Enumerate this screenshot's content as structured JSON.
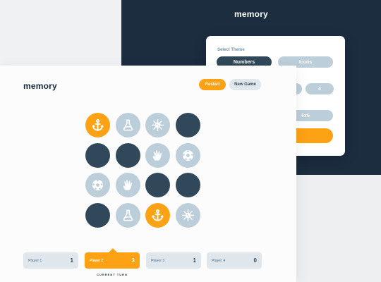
{
  "start_screen": {
    "logo": "memory",
    "select_theme_label": "Select Theme",
    "themes": [
      "Numbers",
      "Icons"
    ],
    "active_theme": "Numbers",
    "visible_player_option": "4",
    "visible_grid_option": "6x6"
  },
  "game": {
    "logo": "memory",
    "restart_label": "Restart",
    "new_game_label": "New Game",
    "tiles": [
      {
        "state": "active",
        "icon": "anchor-icon"
      },
      {
        "state": "revealed",
        "icon": "flask-icon"
      },
      {
        "state": "revealed",
        "icon": "virus-icon"
      },
      {
        "state": "hidden",
        "icon": ""
      },
      {
        "state": "hidden",
        "icon": ""
      },
      {
        "state": "hidden",
        "icon": ""
      },
      {
        "state": "revealed",
        "icon": "hand-spock-icon"
      },
      {
        "state": "revealed",
        "icon": "futbol-icon"
      },
      {
        "state": "revealed",
        "icon": "futbol-icon"
      },
      {
        "state": "revealed",
        "icon": "hand-spock-icon"
      },
      {
        "state": "hidden",
        "icon": ""
      },
      {
        "state": "hidden",
        "icon": ""
      },
      {
        "state": "hidden",
        "icon": ""
      },
      {
        "state": "revealed",
        "icon": "flask-icon"
      },
      {
        "state": "active",
        "icon": "anchor-icon"
      },
      {
        "state": "revealed",
        "icon": "virus-icon"
      }
    ],
    "players": [
      {
        "name": "Player 1",
        "score": "1",
        "current": false
      },
      {
        "name": "Player 2",
        "score": "3",
        "current": true
      },
      {
        "name": "Player 3",
        "score": "1",
        "current": false
      },
      {
        "name": "Player 4",
        "score": "0",
        "current": false
      }
    ],
    "current_turn_label": "CURRENT TURN"
  },
  "colors": {
    "navy": "#152938",
    "dark_tile": "#304859",
    "light_tile": "#bcced9",
    "orange": "#fda214",
    "card_bg": "#dfe7ec"
  }
}
